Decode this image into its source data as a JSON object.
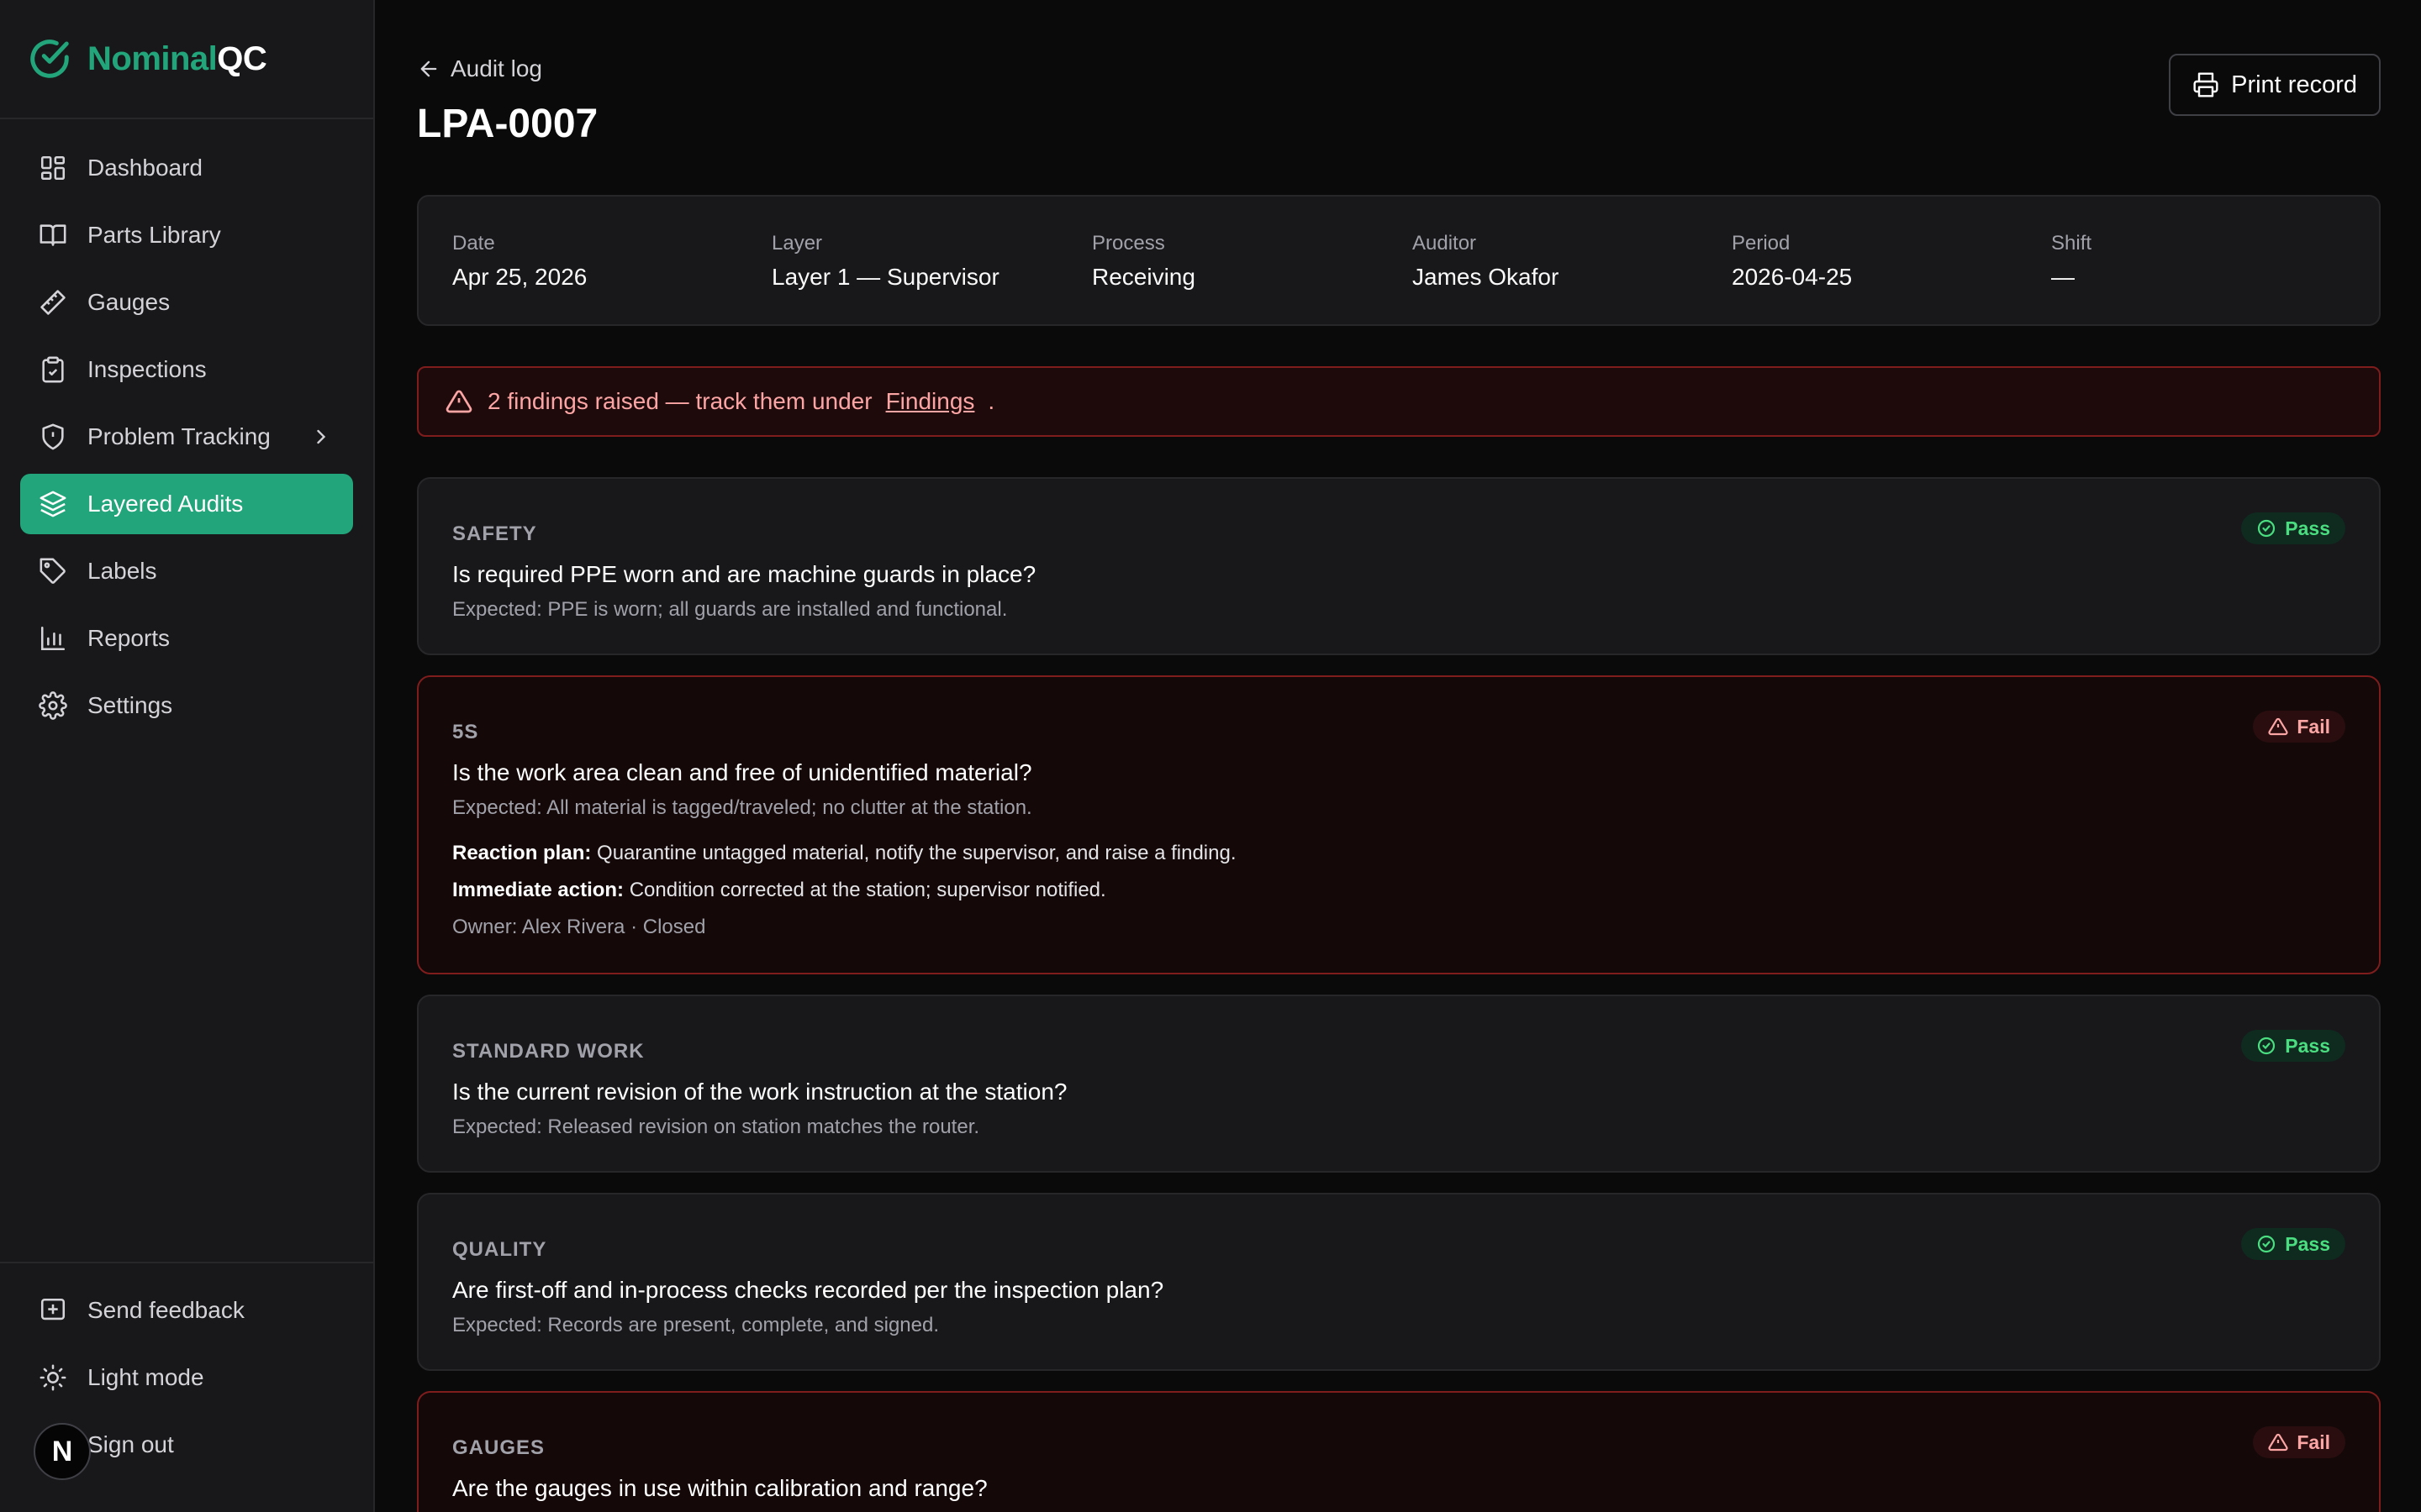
{
  "brand": {
    "part1": "Nominal",
    "part2": "QC"
  },
  "sidebar": {
    "items": [
      {
        "label": "Dashboard",
        "icon": "dashboard-icon"
      },
      {
        "label": "Parts Library",
        "icon": "book-icon"
      },
      {
        "label": "Gauges",
        "icon": "ruler-icon"
      },
      {
        "label": "Inspections",
        "icon": "clipboard-check-icon"
      },
      {
        "label": "Problem Tracking",
        "icon": "shield-alert-icon"
      },
      {
        "label": "Layered Audits",
        "icon": "layers-icon"
      },
      {
        "label": "Labels",
        "icon": "tag-icon"
      },
      {
        "label": "Reports",
        "icon": "bar-chart-icon"
      },
      {
        "label": "Settings",
        "icon": "gear-icon"
      }
    ],
    "bottom": [
      {
        "label": "Send feedback",
        "icon": "message-plus-icon"
      },
      {
        "label": "Light mode",
        "icon": "sun-icon"
      },
      {
        "label": "Sign out",
        "icon": "logout-icon"
      }
    ],
    "avatar_letter": "N"
  },
  "header": {
    "back_label": "Audit log",
    "title": "LPA-0007",
    "print_label": "Print record"
  },
  "meta": [
    {
      "label": "Date",
      "value": "Apr 25, 2026"
    },
    {
      "label": "Layer",
      "value": "Layer 1 — Supervisor"
    },
    {
      "label": "Process",
      "value": "Receiving"
    },
    {
      "label": "Auditor",
      "value": "James Okafor"
    },
    {
      "label": "Period",
      "value": "2026-04-25"
    },
    {
      "label": "Shift",
      "value": "—"
    }
  ],
  "alert": {
    "text": "2 findings raised — track them under",
    "link": "Findings",
    "suffix": "."
  },
  "questions": [
    {
      "category": "SAFETY",
      "question": "Is required PPE worn and are machine guards in place?",
      "expected": "Expected: PPE is worn; all guards are installed and functional.",
      "result": "Pass"
    },
    {
      "category": "5S",
      "question": "Is the work area clean and free of unidentified material?",
      "expected": "Expected: All material is tagged/traveled; no clutter at the station.",
      "result": "Fail",
      "reaction_label": "Reaction plan:",
      "reaction_text": "Quarantine untagged material, notify the supervisor, and raise a finding.",
      "action_label": "Immediate action:",
      "action_text": "Condition corrected at the station; supervisor notified.",
      "owner": "Owner: Alex Rivera · Closed"
    },
    {
      "category": "STANDARD WORK",
      "question": "Is the current revision of the work instruction at the station?",
      "expected": "Expected: Released revision on station matches the router.",
      "result": "Pass"
    },
    {
      "category": "QUALITY",
      "question": "Are first-off and in-process checks recorded per the inspection plan?",
      "expected": "Expected: Records are present, complete, and signed.",
      "result": "Pass"
    },
    {
      "category": "GAUGES",
      "question": "Are the gauges in use within calibration and range?",
      "result": "Fail"
    }
  ],
  "colors": {
    "accent": "#22a57a",
    "pass": "#4ade80",
    "fail": "#fca5a5",
    "fail_border": "#7f1d1d"
  }
}
